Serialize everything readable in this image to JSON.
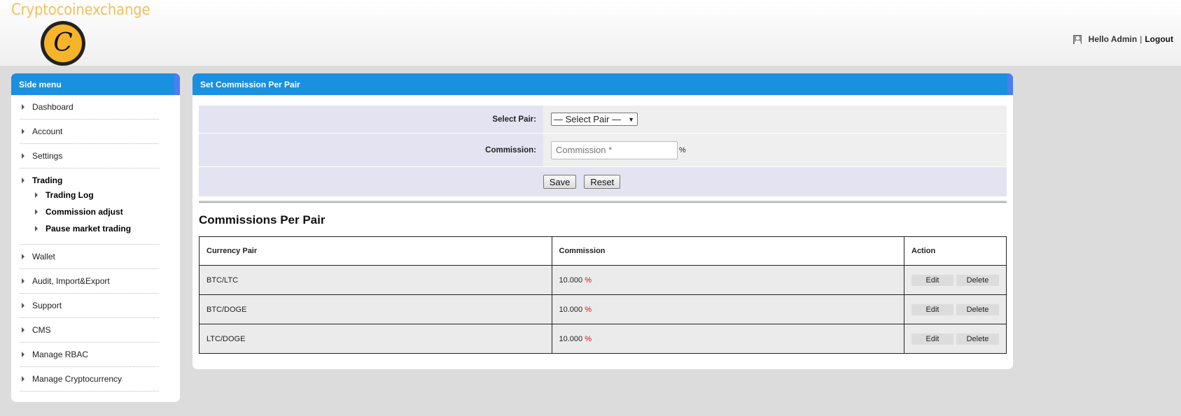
{
  "header": {
    "brand": "Cryptocoinexchange",
    "logo_letter": "C",
    "greeting": "Hello Admin",
    "separator": "|",
    "logout": "Logout"
  },
  "sidebar": {
    "title": "Side menu",
    "items": [
      {
        "label": "Dashboard"
      },
      {
        "label": "Account"
      },
      {
        "label": "Settings"
      },
      {
        "label": "Trading",
        "children": [
          {
            "label": "Trading Log"
          },
          {
            "label": "Commission adjust"
          },
          {
            "label": "Pause market trading"
          }
        ]
      },
      {
        "label": "Wallet"
      },
      {
        "label": "Audit, Import&Export"
      },
      {
        "label": "Support"
      },
      {
        "label": "CMS"
      },
      {
        "label": "Manage RBAC"
      },
      {
        "label": "Manage Cryptocurrency"
      }
    ]
  },
  "main": {
    "title": "Set Commission Per Pair",
    "form": {
      "select_pair_label": "Select Pair:",
      "select_pair_value": "— Select Pair —",
      "commission_label": "Commission:",
      "commission_placeholder": "Commission *",
      "commission_unit": "%",
      "save": "Save",
      "reset": "Reset"
    },
    "table_title": "Commissions Per Pair",
    "table": {
      "columns": [
        "Currency Pair",
        "Commission",
        "Action"
      ],
      "rows": [
        {
          "pair": "BTC/LTC",
          "commission": "10.000",
          "unit": "%",
          "edit": "Edit",
          "delete": "Delete"
        },
        {
          "pair": "BTC/DOGE",
          "commission": "10.000",
          "unit": "%",
          "edit": "Edit",
          "delete": "Delete"
        },
        {
          "pair": "LTC/DOGE",
          "commission": "10.000",
          "unit": "%",
          "edit": "Edit",
          "delete": "Delete"
        }
      ]
    }
  }
}
